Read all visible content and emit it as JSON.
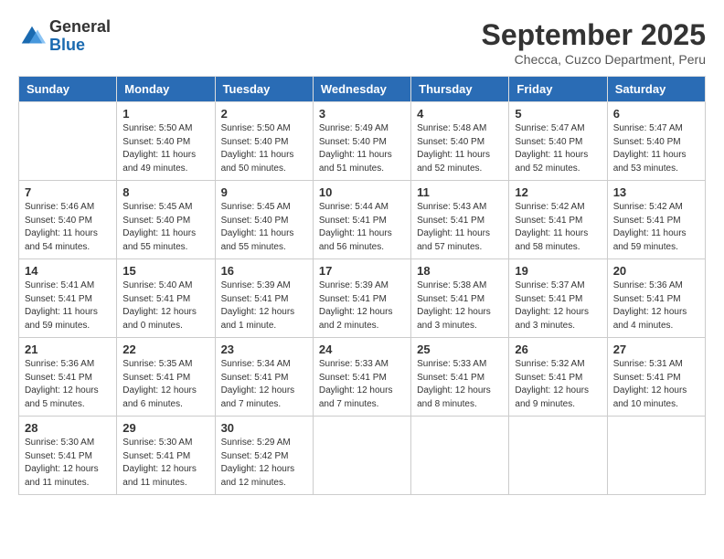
{
  "logo": {
    "general": "General",
    "blue": "Blue"
  },
  "title": "September 2025",
  "location": "Checca, Cuzco Department, Peru",
  "days_of_week": [
    "Sunday",
    "Monday",
    "Tuesday",
    "Wednesday",
    "Thursday",
    "Friday",
    "Saturday"
  ],
  "weeks": [
    [
      {
        "day": "",
        "info": ""
      },
      {
        "day": "1",
        "info": "Sunrise: 5:50 AM\nSunset: 5:40 PM\nDaylight: 11 hours\nand 49 minutes."
      },
      {
        "day": "2",
        "info": "Sunrise: 5:50 AM\nSunset: 5:40 PM\nDaylight: 11 hours\nand 50 minutes."
      },
      {
        "day": "3",
        "info": "Sunrise: 5:49 AM\nSunset: 5:40 PM\nDaylight: 11 hours\nand 51 minutes."
      },
      {
        "day": "4",
        "info": "Sunrise: 5:48 AM\nSunset: 5:40 PM\nDaylight: 11 hours\nand 52 minutes."
      },
      {
        "day": "5",
        "info": "Sunrise: 5:47 AM\nSunset: 5:40 PM\nDaylight: 11 hours\nand 52 minutes."
      },
      {
        "day": "6",
        "info": "Sunrise: 5:47 AM\nSunset: 5:40 PM\nDaylight: 11 hours\nand 53 minutes."
      }
    ],
    [
      {
        "day": "7",
        "info": "Sunrise: 5:46 AM\nSunset: 5:40 PM\nDaylight: 11 hours\nand 54 minutes."
      },
      {
        "day": "8",
        "info": "Sunrise: 5:45 AM\nSunset: 5:40 PM\nDaylight: 11 hours\nand 55 minutes."
      },
      {
        "day": "9",
        "info": "Sunrise: 5:45 AM\nSunset: 5:40 PM\nDaylight: 11 hours\nand 55 minutes."
      },
      {
        "day": "10",
        "info": "Sunrise: 5:44 AM\nSunset: 5:41 PM\nDaylight: 11 hours\nand 56 minutes."
      },
      {
        "day": "11",
        "info": "Sunrise: 5:43 AM\nSunset: 5:41 PM\nDaylight: 11 hours\nand 57 minutes."
      },
      {
        "day": "12",
        "info": "Sunrise: 5:42 AM\nSunset: 5:41 PM\nDaylight: 11 hours\nand 58 minutes."
      },
      {
        "day": "13",
        "info": "Sunrise: 5:42 AM\nSunset: 5:41 PM\nDaylight: 11 hours\nand 59 minutes."
      }
    ],
    [
      {
        "day": "14",
        "info": "Sunrise: 5:41 AM\nSunset: 5:41 PM\nDaylight: 11 hours\nand 59 minutes."
      },
      {
        "day": "15",
        "info": "Sunrise: 5:40 AM\nSunset: 5:41 PM\nDaylight: 12 hours\nand 0 minutes."
      },
      {
        "day": "16",
        "info": "Sunrise: 5:39 AM\nSunset: 5:41 PM\nDaylight: 12 hours\nand 1 minute."
      },
      {
        "day": "17",
        "info": "Sunrise: 5:39 AM\nSunset: 5:41 PM\nDaylight: 12 hours\nand 2 minutes."
      },
      {
        "day": "18",
        "info": "Sunrise: 5:38 AM\nSunset: 5:41 PM\nDaylight: 12 hours\nand 3 minutes."
      },
      {
        "day": "19",
        "info": "Sunrise: 5:37 AM\nSunset: 5:41 PM\nDaylight: 12 hours\nand 3 minutes."
      },
      {
        "day": "20",
        "info": "Sunrise: 5:36 AM\nSunset: 5:41 PM\nDaylight: 12 hours\nand 4 minutes."
      }
    ],
    [
      {
        "day": "21",
        "info": "Sunrise: 5:36 AM\nSunset: 5:41 PM\nDaylight: 12 hours\nand 5 minutes."
      },
      {
        "day": "22",
        "info": "Sunrise: 5:35 AM\nSunset: 5:41 PM\nDaylight: 12 hours\nand 6 minutes."
      },
      {
        "day": "23",
        "info": "Sunrise: 5:34 AM\nSunset: 5:41 PM\nDaylight: 12 hours\nand 7 minutes."
      },
      {
        "day": "24",
        "info": "Sunrise: 5:33 AM\nSunset: 5:41 PM\nDaylight: 12 hours\nand 7 minutes."
      },
      {
        "day": "25",
        "info": "Sunrise: 5:33 AM\nSunset: 5:41 PM\nDaylight: 12 hours\nand 8 minutes."
      },
      {
        "day": "26",
        "info": "Sunrise: 5:32 AM\nSunset: 5:41 PM\nDaylight: 12 hours\nand 9 minutes."
      },
      {
        "day": "27",
        "info": "Sunrise: 5:31 AM\nSunset: 5:41 PM\nDaylight: 12 hours\nand 10 minutes."
      }
    ],
    [
      {
        "day": "28",
        "info": "Sunrise: 5:30 AM\nSunset: 5:41 PM\nDaylight: 12 hours\nand 11 minutes."
      },
      {
        "day": "29",
        "info": "Sunrise: 5:30 AM\nSunset: 5:41 PM\nDaylight: 12 hours\nand 11 minutes."
      },
      {
        "day": "30",
        "info": "Sunrise: 5:29 AM\nSunset: 5:42 PM\nDaylight: 12 hours\nand 12 minutes."
      },
      {
        "day": "",
        "info": ""
      },
      {
        "day": "",
        "info": ""
      },
      {
        "day": "",
        "info": ""
      },
      {
        "day": "",
        "info": ""
      }
    ]
  ]
}
